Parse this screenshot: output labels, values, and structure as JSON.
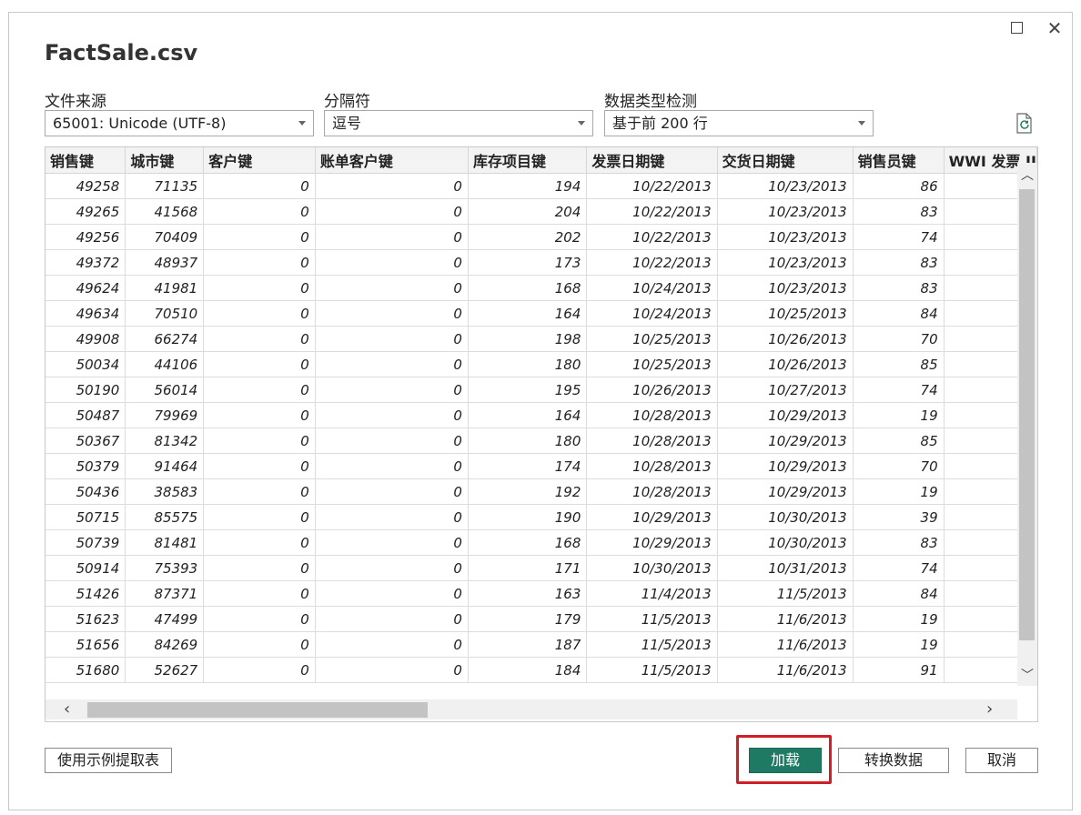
{
  "dialog": {
    "title": "FactSale.csv"
  },
  "fields": {
    "file_origin": {
      "label": "文件来源",
      "value": "65001: Unicode (UTF-8)"
    },
    "delimiter": {
      "label": "分隔符",
      "value": "逗号"
    },
    "type_detection": {
      "label": "数据类型检测",
      "value": "基于前 200 行"
    }
  },
  "table": {
    "columns": [
      "销售键",
      "城市键",
      "客户键",
      "账单客户键",
      "库存项目键",
      "发票日期键",
      "交货日期键",
      "销售员键",
      "WWI 发票 II"
    ],
    "rows": [
      [
        "49258",
        "71135",
        "0",
        "0",
        "194",
        "10/22/2013",
        "10/23/2013",
        "86"
      ],
      [
        "49265",
        "41568",
        "0",
        "0",
        "204",
        "10/22/2013",
        "10/23/2013",
        "83"
      ],
      [
        "49256",
        "70409",
        "0",
        "0",
        "202",
        "10/22/2013",
        "10/23/2013",
        "74"
      ],
      [
        "49372",
        "48937",
        "0",
        "0",
        "173",
        "10/22/2013",
        "10/23/2013",
        "83"
      ],
      [
        "49624",
        "41981",
        "0",
        "0",
        "168",
        "10/24/2013",
        "10/23/2013",
        "83"
      ],
      [
        "49634",
        "70510",
        "0",
        "0",
        "164",
        "10/24/2013",
        "10/25/2013",
        "84"
      ],
      [
        "49908",
        "66274",
        "0",
        "0",
        "198",
        "10/25/2013",
        "10/26/2013",
        "70"
      ],
      [
        "50034",
        "44106",
        "0",
        "0",
        "180",
        "10/25/2013",
        "10/26/2013",
        "85"
      ],
      [
        "50190",
        "56014",
        "0",
        "0",
        "195",
        "10/26/2013",
        "10/27/2013",
        "74"
      ],
      [
        "50487",
        "79969",
        "0",
        "0",
        "164",
        "10/28/2013",
        "10/29/2013",
        "19"
      ],
      [
        "50367",
        "81342",
        "0",
        "0",
        "180",
        "10/28/2013",
        "10/29/2013",
        "85"
      ],
      [
        "50379",
        "91464",
        "0",
        "0",
        "174",
        "10/28/2013",
        "10/29/2013",
        "70"
      ],
      [
        "50436",
        "38583",
        "0",
        "0",
        "192",
        "10/28/2013",
        "10/29/2013",
        "19"
      ],
      [
        "50715",
        "85575",
        "0",
        "0",
        "190",
        "10/29/2013",
        "10/30/2013",
        "39"
      ],
      [
        "50739",
        "81481",
        "0",
        "0",
        "168",
        "10/29/2013",
        "10/30/2013",
        "83"
      ],
      [
        "50914",
        "75393",
        "0",
        "0",
        "171",
        "10/30/2013",
        "10/31/2013",
        "74"
      ],
      [
        "51426",
        "87371",
        "0",
        "0",
        "163",
        "11/4/2013",
        "11/5/2013",
        "84"
      ],
      [
        "51623",
        "47499",
        "0",
        "0",
        "179",
        "11/5/2013",
        "11/6/2013",
        "19"
      ],
      [
        "51656",
        "84269",
        "0",
        "0",
        "187",
        "11/5/2013",
        "11/6/2013",
        "19"
      ],
      [
        "51680",
        "52627",
        "0",
        "0",
        "184",
        "11/5/2013",
        "11/6/2013",
        "91"
      ]
    ]
  },
  "buttons": {
    "extract_table": "使用示例提取表",
    "load": "加载",
    "transform": "转换数据",
    "cancel": "取消"
  },
  "icons": {
    "maximize": "maximize-icon",
    "close": "close-icon",
    "refresh": "refresh-preview-icon"
  },
  "colors": {
    "primary": "#1f7a63",
    "highlight": "#d11e26"
  }
}
